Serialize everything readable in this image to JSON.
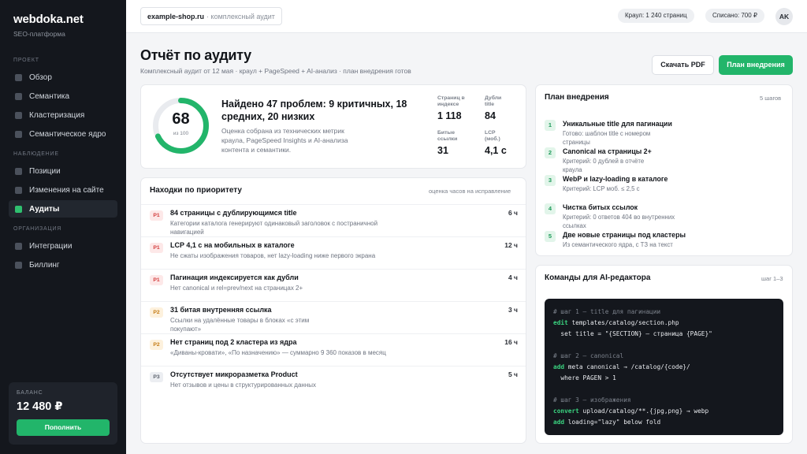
{
  "sidebar": {
    "logo": "webdoka.net",
    "subtitle": "SEO-платформа",
    "sections": [
      "ПРОЕКТ",
      "НАБЛЮДЕНИЕ",
      "ОРГАНИЗАЦИЯ"
    ],
    "items": [
      {
        "label": "Обзор"
      },
      {
        "label": "Семантика"
      },
      {
        "label": "Кластеризация"
      },
      {
        "label": "Семантическое ядро"
      },
      {
        "label": "Позиции"
      },
      {
        "label": "Изменения на сайте"
      },
      {
        "label": "Аудиты",
        "active": true
      },
      {
        "label": "Интеграции"
      },
      {
        "label": "Биллинг"
      }
    ],
    "balance": {
      "label": "БАЛАНС",
      "value": "12 480 ₽",
      "button": "Пополнить"
    }
  },
  "topbar": {
    "domain": "example-shop.ru",
    "context": "· комплексный аудит",
    "crawl": "Краул: 1 240 страниц",
    "charged": "Списано: 700 ₽",
    "avatar": "AK"
  },
  "header": {
    "title": "Отчёт по аудиту",
    "subtitle": "Комплексный аудит от 12 мая · краул + PageSpeed + AI-анализ · план внедрения готов",
    "download_button": "Скачать PDF",
    "plan_button": "План внедрения"
  },
  "score": {
    "value": "68",
    "out_of": "из 100",
    "fraction": 0.68,
    "headline": "Найдено 47 проблем: 9 критичных, 18 средних, 20 низких",
    "description": "Оценка собрана из технических метрик краула, PageSpeed Insights и AI-анализа контента и семантики.",
    "metrics": [
      {
        "label": "Страниц в индексе",
        "value": "1 118"
      },
      {
        "label": "Дубли title",
        "value": "84"
      },
      {
        "label": "Битые ссылки",
        "value": "31"
      },
      {
        "label": "LCP (моб.)",
        "value": "4,1 с"
      }
    ]
  },
  "findings": {
    "title": "Находки по приоритету",
    "meta": "оценка часов на исправление",
    "items": [
      {
        "priority": "P1",
        "title": "84 страницы с дублирующимся title",
        "description": "Категории каталога генерируют одинаковый заголовок с постраничной навигацией",
        "hours": "6 ч"
      },
      {
        "priority": "P1",
        "title": "LCP 4,1 с на мобильных в каталоге",
        "description": "Не сжаты изображения товаров, нет lazy-loading ниже первого экрана",
        "hours": "12 ч"
      },
      {
        "priority": "P1",
        "title": "Пагинация индексируется как дубли",
        "description": "Нет canonical и rel=prev/next на страницах 2+",
        "hours": "4 ч"
      },
      {
        "priority": "P2",
        "title": "31 битая внутренняя ссылка",
        "description": "Ссылки на удалённые товары в блоках «с этим покупают»",
        "hours": "3 ч"
      },
      {
        "priority": "P2",
        "title": "Нет страниц под 2 кластера из ядра",
        "description": "«Диваны-кровати», «По назначению» — суммарно 9 360 показов в месяц",
        "hours": "16 ч"
      },
      {
        "priority": "P3",
        "title": "Отсутствует микроразметка Product",
        "description": "Нет отзывов и цены в структурированных данных",
        "hours": "5 ч"
      }
    ]
  },
  "plan": {
    "title": "План внедрения",
    "meta": "5 шагов",
    "steps": [
      {
        "num": "1",
        "title": "Уникальные title для пагинации",
        "description": "Готово: шаблон title с номером страницы"
      },
      {
        "num": "2",
        "title": "Canonical на страницы 2+",
        "description": "Критерий: 0 дублей в отчёте краула"
      },
      {
        "num": "3",
        "title": "WebP и lazy-loading в каталоге",
        "description": "Критерий: LCP моб. ≤ 2,5 с"
      },
      {
        "num": "4",
        "title": "Чистка битых ссылок",
        "description": "Критерий: 0 ответов 404 во внутренних ссылках"
      },
      {
        "num": "5",
        "title": "Две новые страницы под кластеры",
        "description": "Из семантического ядра, с ТЗ на текст"
      }
    ]
  },
  "commands": {
    "title": "Команды для AI-редактора",
    "meta": "шаг 1–3",
    "lines": [
      {
        "kw": "",
        "text": "# шаг 1 — title для пагинации",
        "comment": true
      },
      {
        "kw": "edit",
        "text": " templates/catalog/section.php"
      },
      {
        "kw": "",
        "text": "  set title = \"{SECTION} — страница {PAGE}\""
      },
      {
        "kw": "",
        "text": ""
      },
      {
        "kw": "",
        "text": "# шаг 2 — canonical",
        "comment": true
      },
      {
        "kw": "add",
        "text": " meta canonical → /catalog/{code}/"
      },
      {
        "kw": "",
        "text": "  where PAGEN > 1"
      },
      {
        "kw": "",
        "text": ""
      },
      {
        "kw": "",
        "text": "# шаг 3 — изображения",
        "comment": true
      },
      {
        "kw": "convert",
        "text": " upload/catalog/**.{jpg,png} → webp"
      },
      {
        "kw": "add",
        "text": " loading=\"lazy\" below fold"
      }
    ]
  },
  "colors": {
    "accent": "#22b56a",
    "sidebar": "#14171d",
    "p1": "#d23b3b",
    "p2": "#c47a12",
    "p3": "#5d636d"
  }
}
